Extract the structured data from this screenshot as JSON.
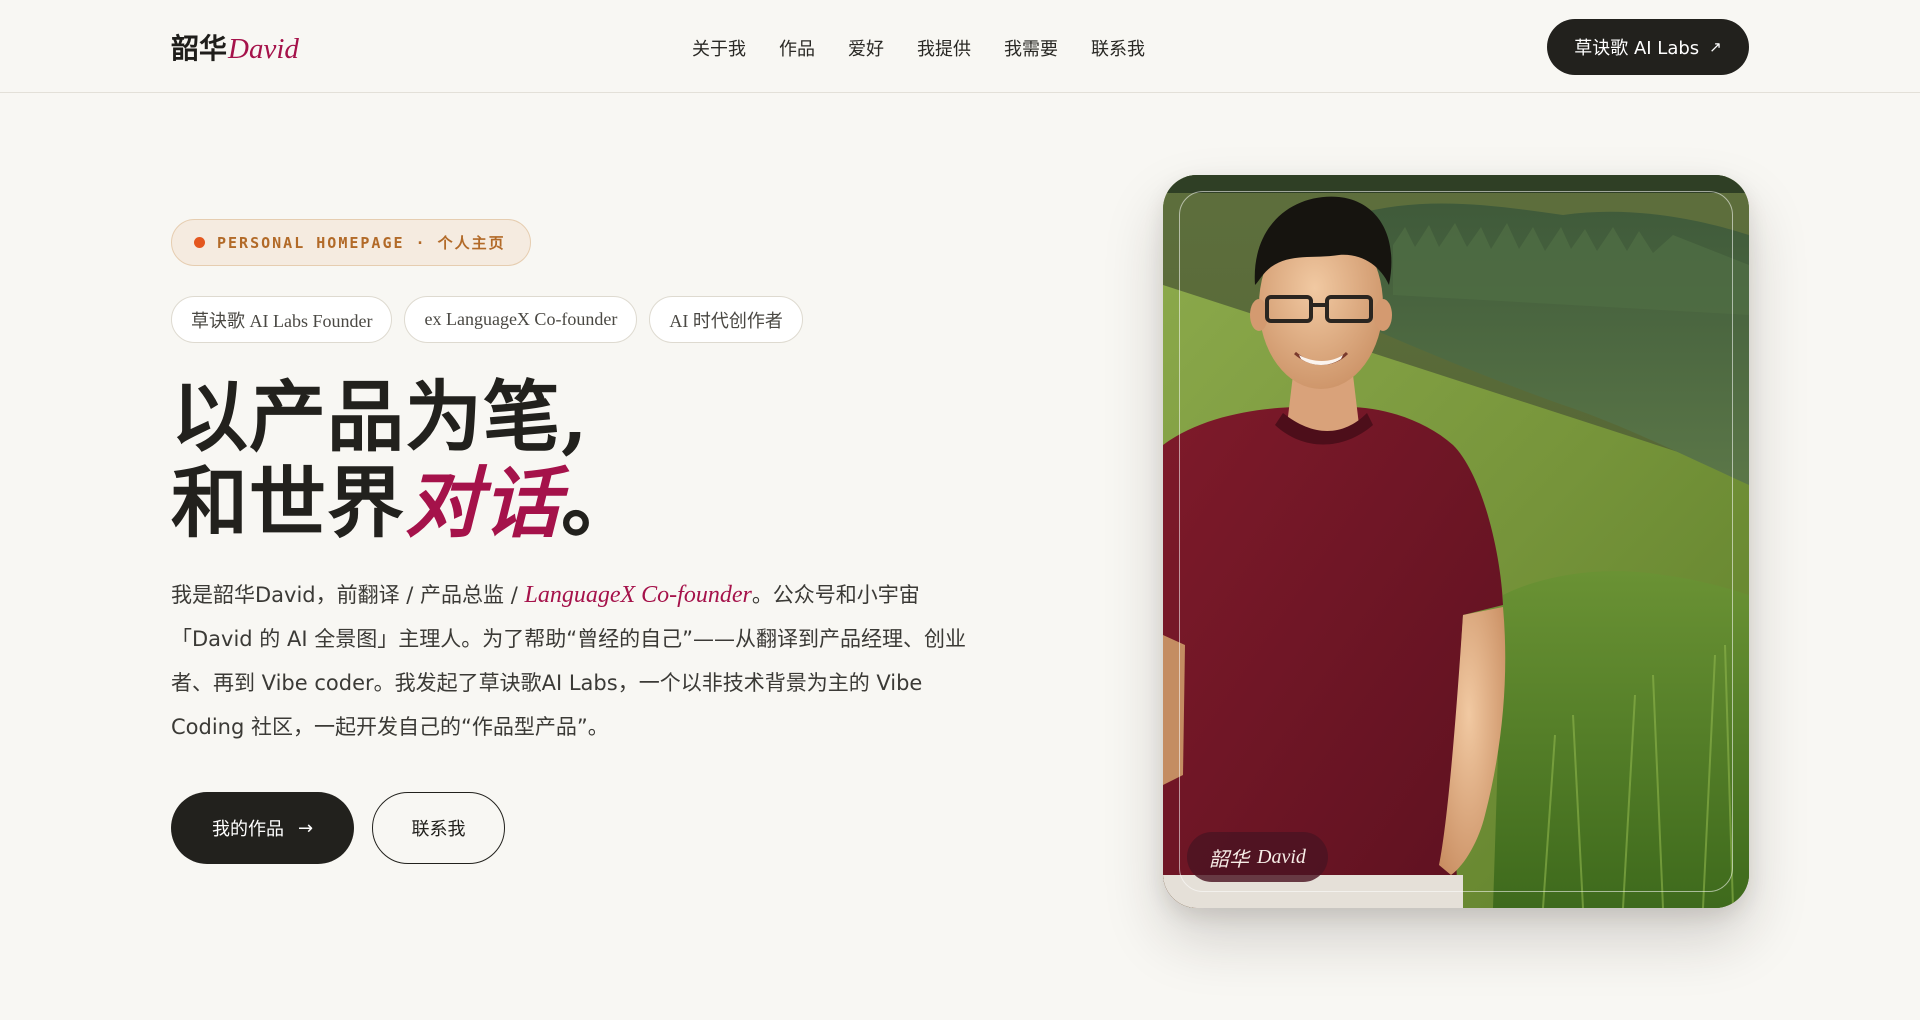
{
  "header": {
    "brand_cn": "韶华",
    "brand_en": "David",
    "nav": [
      "关于我",
      "作品",
      "爱好",
      "我提供",
      "我需要",
      "联系我"
    ],
    "labs_button": "草诀歌 AI Labs",
    "labs_arrow": "↗"
  },
  "hero": {
    "eyebrow": "PERSONAL HOMEPAGE · 个人主页",
    "tags": [
      "草诀歌 AI Labs Founder",
      "ex LanguageX Co-founder",
      "AI 时代创作者"
    ],
    "headline_line1": "以产品为笔,",
    "headline_line2_prefix": "和世界",
    "headline_line2_accent": "对话",
    "headline_line2_suffix": "。",
    "intro_part1": "我是韶华David，前翻译 / 产品总监 / ",
    "intro_em": "LanguageX Co-founder",
    "intro_part2": "。公众号和小宇宙「David 的 AI 全景图」主理人。为了帮助“曾经的自己”——从翻译到产品经理、创业者、再到 Vibe coder。我发起了草诀歌AI Labs，一个以非技术背景为主的 Vibe Coding 社区，一起开发自己的“作品型产品”。",
    "cta_primary": "我的作品",
    "cta_primary_arrow": "→",
    "cta_secondary": "联系我"
  },
  "portrait": {
    "caption_cn": "韶华",
    "caption_en": "David"
  },
  "colors": {
    "background": "#f8f7f3",
    "accent": "#a5124a",
    "dark": "#22211d",
    "eyebrow_text": "#b26a28",
    "eyebrow_dot": "#e4571f"
  }
}
